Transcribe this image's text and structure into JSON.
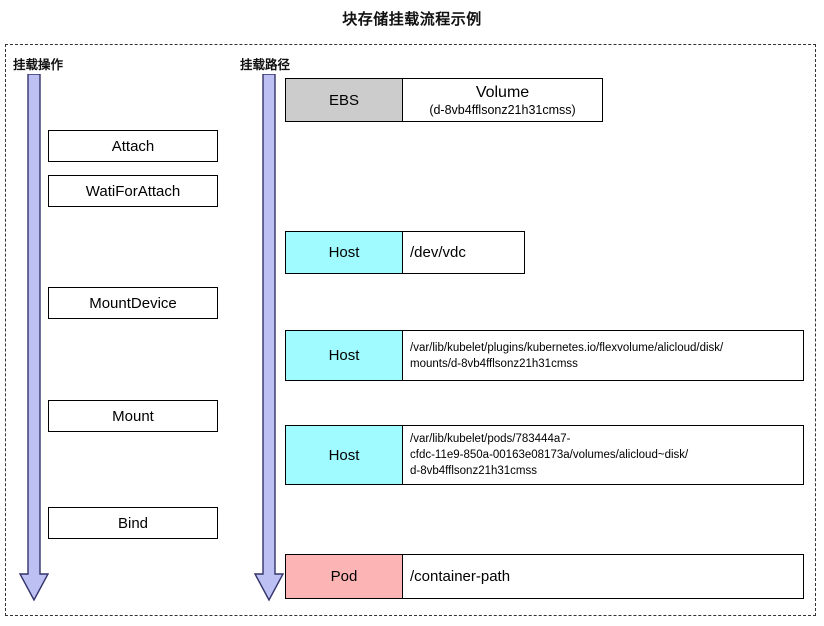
{
  "title": "块存储挂载流程示例",
  "lanes": {
    "operation": {
      "caption": "挂载操作"
    },
    "path": {
      "caption": "挂载路径"
    }
  },
  "colors": {
    "arrow_fill": "#bcc0f2",
    "arrow_stroke": "#33336a",
    "ebs_fill": "#cccccc",
    "host_fill": "#9ffbff",
    "pod_fill": "#fcb4b4",
    "box_border": "#000000",
    "frame_border": "#333333"
  },
  "operation_steps": [
    {
      "label": "Attach"
    },
    {
      "label": "WatiForAttach"
    },
    {
      "label": "MountDevice"
    },
    {
      "label": "Mount"
    },
    {
      "label": "Bind"
    }
  ],
  "path_rows": [
    {
      "label": "EBS",
      "label_fill": "gray",
      "value_main": "Volume",
      "value_sub": "(d-8vb4fflsonz21h31cmss)"
    },
    {
      "label": "Host",
      "label_fill": "cyan",
      "value_plain": "/dev/vdc"
    },
    {
      "label": "Host",
      "label_fill": "cyan",
      "value_line1": "/var/lib/kubelet/plugins/kubernetes.io/flexvolume/alicloud/disk/",
      "value_line2": "mounts/d-8vb4fflsonz21h31cmss"
    },
    {
      "label": "Host",
      "label_fill": "cyan",
      "value_line1": "/var/lib/kubelet/pods/783444a7-",
      "value_line2": "cfdc-11e9-850a-00163e08173a/volumes/alicloud~disk/",
      "value_line3": "d-8vb4fflsonz21h31cmss"
    },
    {
      "label": "Pod",
      "label_fill": "pink",
      "value_plain": "/container-path"
    }
  ]
}
